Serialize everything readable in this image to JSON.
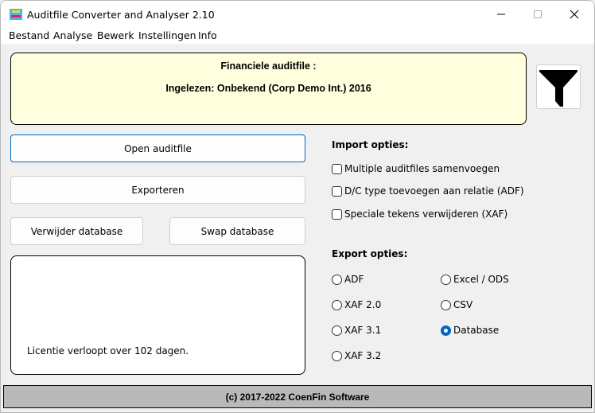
{
  "window": {
    "title": "Auditfile Converter and Analyser 2.10",
    "controls": [
      "minimize",
      "maximize",
      "close"
    ]
  },
  "menu": {
    "items": [
      "Bestand",
      "Analyse",
      "Bewerk",
      "Instellingen",
      "Info"
    ]
  },
  "info_panel": {
    "heading": "Financiele auditfile :",
    "loaded": "Ingelezen: Onbekend (Corp Demo Int.)  2016",
    "background": "#ffffde"
  },
  "filter_button": {
    "icon": "filter-icon"
  },
  "buttons": {
    "open": "Open auditfile",
    "export": "Exporteren",
    "delete_db": "Verwijder database",
    "swap_db": "Swap database"
  },
  "license": {
    "text": "Licentie verloopt over 102 dagen."
  },
  "import_options": {
    "title": "Import opties:",
    "items": [
      {
        "label": "Multiple auditfiles samenvoegen",
        "checked": false
      },
      {
        "label": "D/C type toevoegen aan relatie (ADF)",
        "checked": false
      },
      {
        "label": "Speciale tekens verwijderen (XAF)",
        "checked": false
      }
    ]
  },
  "export_options": {
    "title": "Export opties:",
    "items": [
      {
        "label": "ADF",
        "selected": false
      },
      {
        "label": "XAF 2.0",
        "selected": false
      },
      {
        "label": "XAF 3.1",
        "selected": false
      },
      {
        "label": "XAF 3.2",
        "selected": false
      },
      {
        "label": "Excel / ODS",
        "selected": false
      },
      {
        "label": "CSV",
        "selected": false
      },
      {
        "label": "Database",
        "selected": true
      }
    ],
    "accent": "#0067c0"
  },
  "footer": {
    "text": "(c) 2017-2022 CoenFin Software"
  }
}
